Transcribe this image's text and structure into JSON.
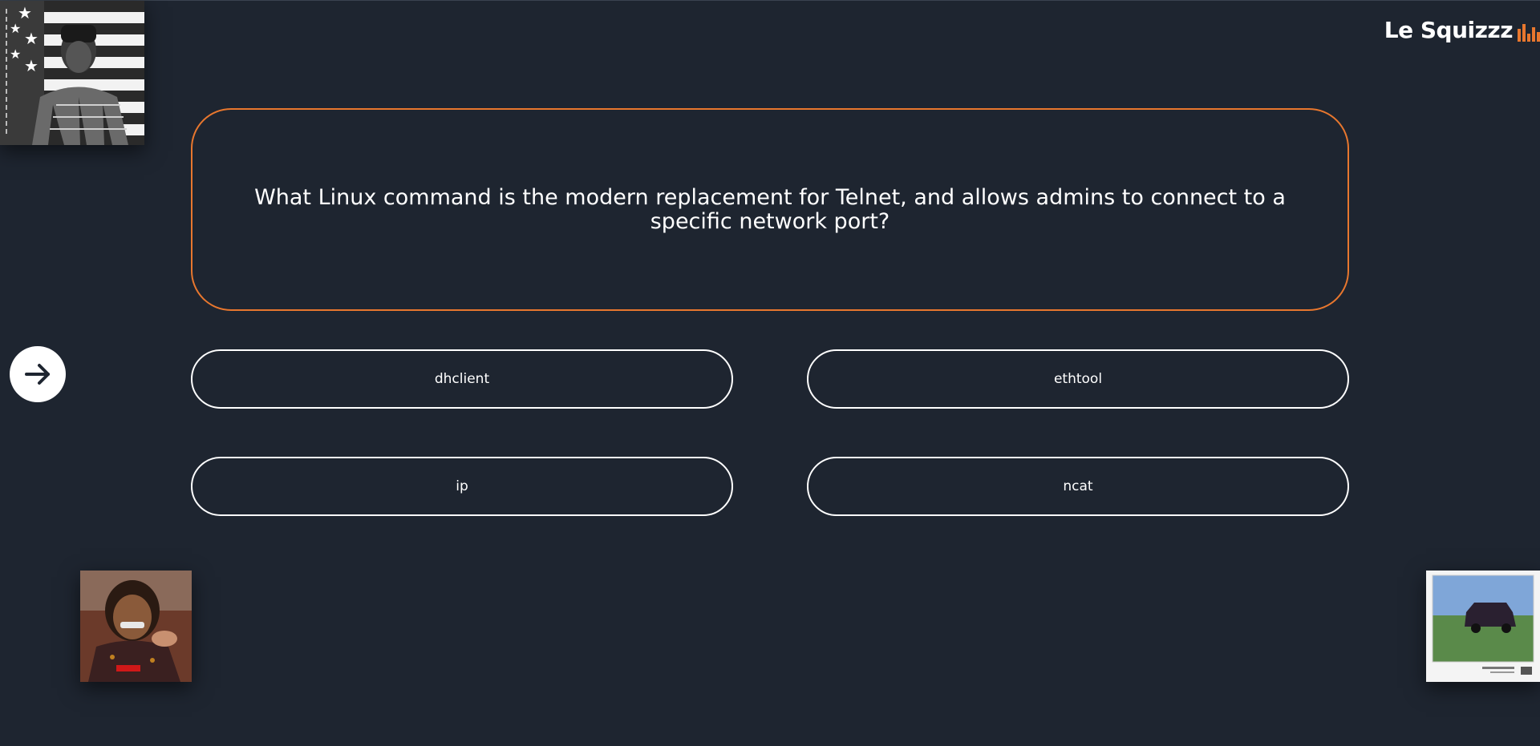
{
  "brand": {
    "name": "Le Squizzz",
    "icon": "equalizer-bars-icon",
    "accent_color": "#e8772e"
  },
  "question": {
    "text": "What Linux command is the modern replacement for Telnet, and allows admins to connect to a specific network port?"
  },
  "answers": [
    {
      "label": "dhclient"
    },
    {
      "label": "ethtool"
    },
    {
      "label": "ip"
    },
    {
      "label": "ncat"
    }
  ],
  "next_button": {
    "icon": "arrow-right-icon"
  },
  "covers": [
    {
      "name": "album-cover-flag-portrait"
    },
    {
      "name": "album-cover-grin-portrait"
    },
    {
      "name": "album-cover-van-photo"
    }
  ],
  "colors": {
    "background": "#1e2530",
    "accent": "#e8772e",
    "foreground": "#ffffff"
  }
}
